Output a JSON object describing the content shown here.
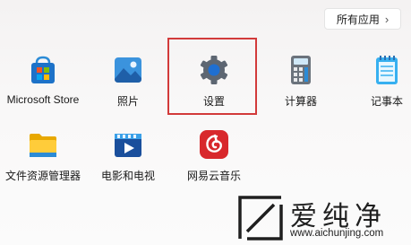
{
  "all_apps_button": {
    "label": "所有应用",
    "chevron": "chevron-right-icon"
  },
  "apps": [
    {
      "label": "Microsoft Store",
      "icon": "microsoft-store-icon"
    },
    {
      "label": "照片",
      "icon": "photos-icon"
    },
    {
      "label": "设置",
      "icon": "settings-gear-icon"
    },
    {
      "label": "计算器",
      "icon": "calculator-icon"
    },
    {
      "label": "记事本",
      "icon": "notepad-icon"
    },
    {
      "label": "文件资源管理器",
      "icon": "file-explorer-icon"
    },
    {
      "label": "电影和电视",
      "icon": "movies-tv-icon"
    },
    {
      "label": "网易云音乐",
      "icon": "netease-music-icon"
    }
  ],
  "watermark": {
    "brand": "爱纯净",
    "url": "www.aichunjing.com"
  },
  "colors": {
    "highlight": "#d23a3a",
    "netease_red": "#d8282c",
    "store_blue": "#1d72c8"
  }
}
